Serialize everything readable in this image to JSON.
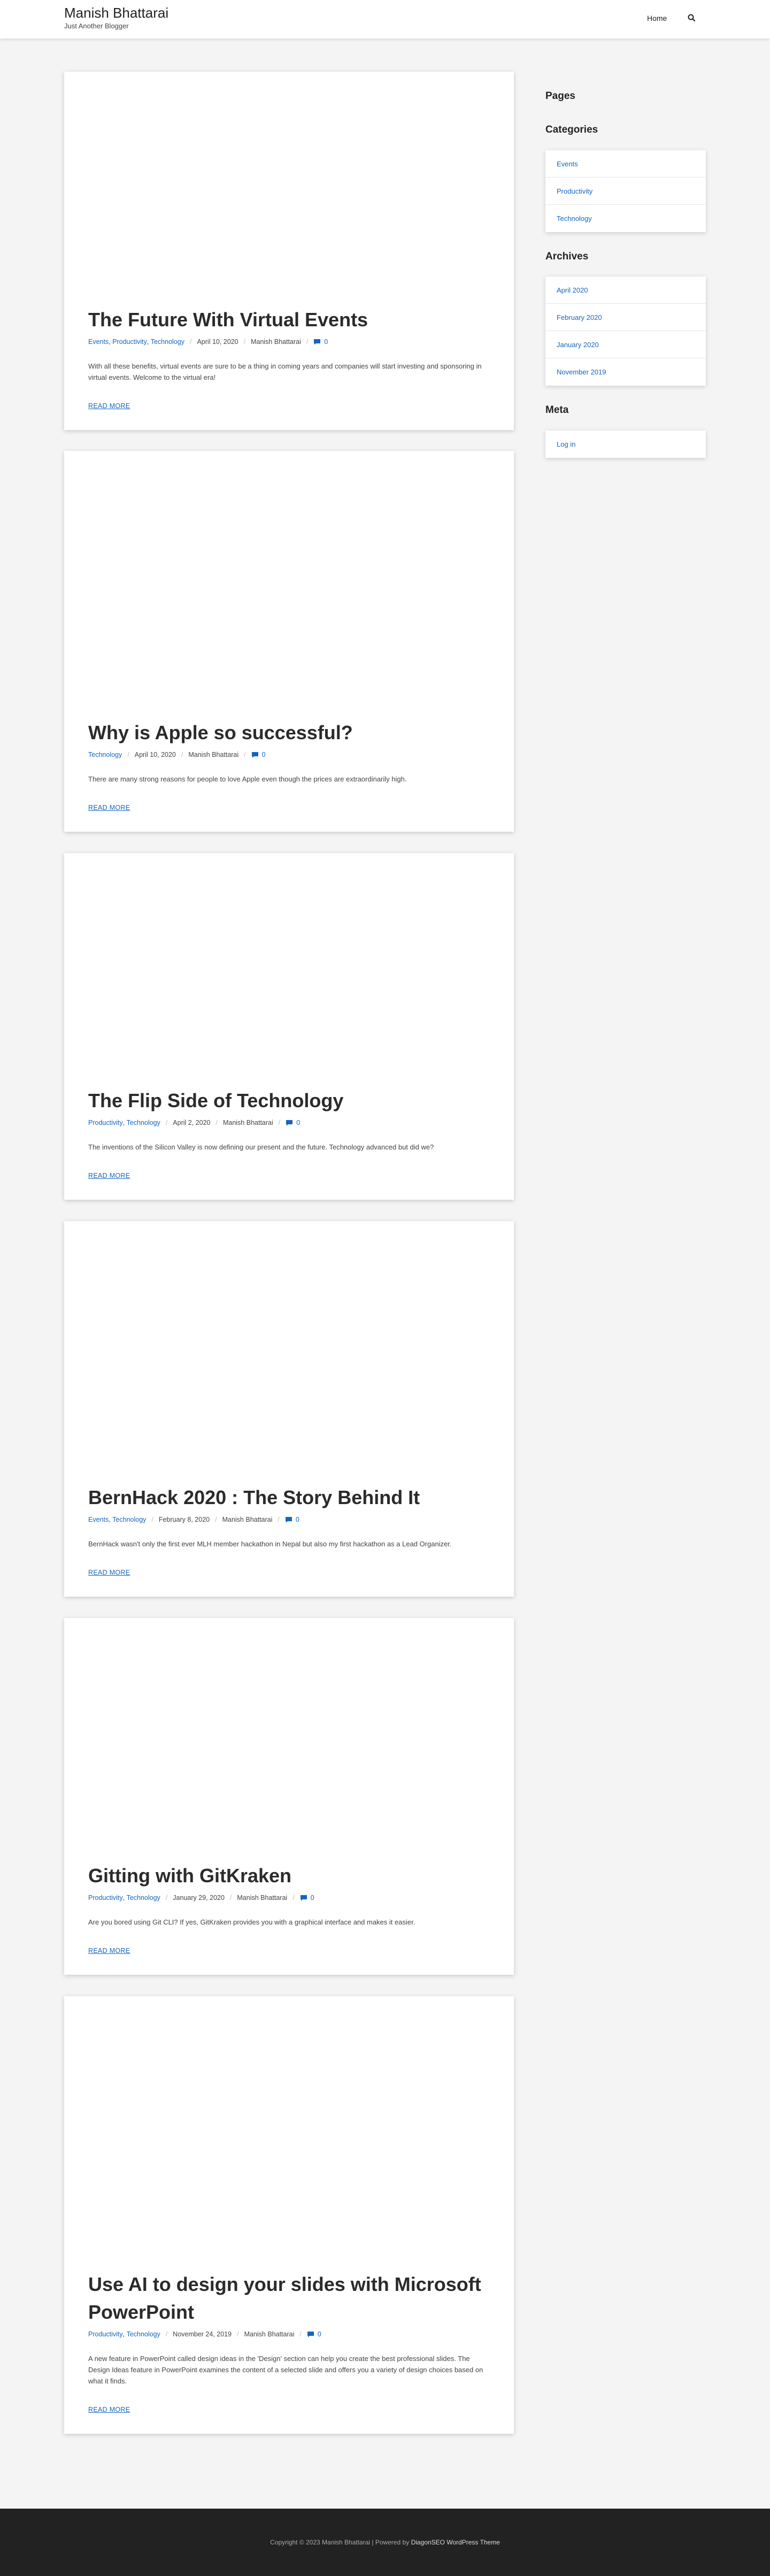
{
  "header": {
    "site_title": "Manish Bhattarai",
    "tagline": "Just Another Blogger",
    "nav_home": "Home",
    "search_icon": "search-icon"
  },
  "posts": [
    {
      "title": "The Future With Virtual Events",
      "categories": [
        "Events",
        "Productivity",
        "Technology"
      ],
      "date": "April 10, 2020",
      "author": "Manish Bhattarai",
      "comments": "0",
      "excerpt": "With all these benefits, virtual events are sure to be a thing in coming years and companies will start investing and sponsoring in virtual events. Welcome to the virtual era!",
      "read_more": "READ MORE"
    },
    {
      "title": "Why is Apple so successful?",
      "categories": [
        "Technology"
      ],
      "date": "April 10, 2020",
      "author": "Manish Bhattarai",
      "comments": "0",
      "excerpt": "There are many strong reasons for people to love Apple even though the prices are extraordinarily high.",
      "read_more": "READ MORE"
    },
    {
      "title": "The Flip Side of Technology",
      "categories": [
        "Productivity",
        "Technology"
      ],
      "date": "April 2, 2020",
      "author": "Manish Bhattarai",
      "comments": "0",
      "excerpt": "The inventions of the Silicon Valley is now defining our present and the future. Technology advanced but did we?",
      "read_more": "READ MORE"
    },
    {
      "title": "BernHack 2020 : The Story Behind It",
      "categories": [
        "Events",
        "Technology"
      ],
      "date": "February 8, 2020",
      "author": "Manish Bhattarai",
      "comments": "0",
      "excerpt": "BernHack wasn't only the first ever MLH member hackathon in Nepal but also my first hackathon as a Lead Organizer.",
      "read_more": "READ MORE"
    },
    {
      "title": "Gitting with GitKraken",
      "categories": [
        "Productivity",
        "Technology"
      ],
      "date": "January 29, 2020",
      "author": "Manish Bhattarai",
      "comments": "0",
      "excerpt": "Are you bored using Git CLI? If yes, GitKraken provides you with a graphical interface and makes it easier.",
      "read_more": "READ MORE"
    },
    {
      "title": "Use AI to design your slides with Microsoft PowerPoint",
      "categories": [
        "Productivity",
        "Technology"
      ],
      "date": "November 24, 2019",
      "author": "Manish Bhattarai",
      "comments": "0",
      "excerpt": "A new feature in PowerPoint called design ideas in the 'Design' section can help you create the best professional slides. The Design Ideas feature in PowerPoint examines the content of a selected slide and offers you a variety of design choices based on what it finds.",
      "read_more": "READ MORE"
    }
  ],
  "sidebar": {
    "pages_title": "Pages",
    "categories_title": "Categories",
    "categories": [
      "Events",
      "Productivity",
      "Technology"
    ],
    "archives_title": "Archives",
    "archives": [
      "April 2020",
      "February 2020",
      "January 2020",
      "November 2019"
    ],
    "meta_title": "Meta",
    "meta": [
      "Log in"
    ]
  },
  "footer": {
    "copyright": "Copyright © 2023 Manish Bhattarai | Powered by",
    "theme_link": "DiagonSEO WordPress Theme"
  },
  "colors": {
    "link": "#1565c0",
    "background": "#f4f4f4",
    "footer": "#222222"
  }
}
